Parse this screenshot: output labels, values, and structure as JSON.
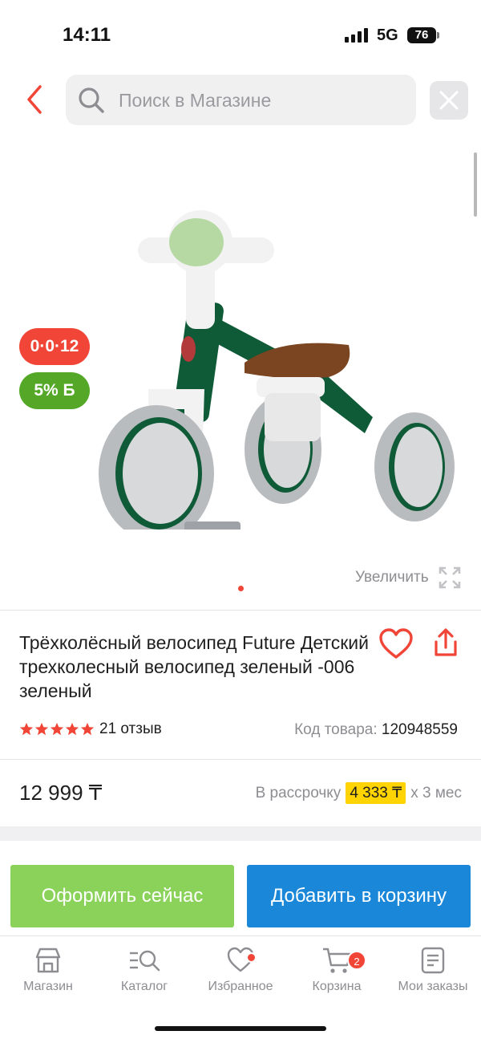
{
  "status_bar": {
    "time": "14:11",
    "network": "5G",
    "battery": "76"
  },
  "header": {
    "search_placeholder": "Поиск в Магазине"
  },
  "gallery": {
    "badges": {
      "age": "0·0·12",
      "bonus": "5% Б"
    },
    "zoom_label": "Увеличить",
    "current_slide": 1
  },
  "product": {
    "title": "Трёхколёсный велосипед Future Детский трехколесный велосипед зеленый -006 зеленый",
    "rating": 5,
    "reviews": "21 отзыв",
    "sku_label": "Код товара:",
    "sku_value": "120948559",
    "price": "12 999 ₸",
    "installment_prefix": "В рассрочку",
    "installment_amount": "4 333 ₸",
    "installment_suffix": "х 3 мес"
  },
  "actions": {
    "buy_now": "Оформить сейчас",
    "add_to_cart": "Добавить в корзину"
  },
  "tabbar": {
    "items": [
      {
        "label": "Магазин",
        "icon": "shop-icon"
      },
      {
        "label": "Каталог",
        "icon": "catalog-search-icon"
      },
      {
        "label": "Избранное",
        "icon": "heart-icon"
      },
      {
        "label": "Корзина",
        "icon": "cart-icon"
      },
      {
        "label": "Мои заказы",
        "icon": "orders-icon"
      }
    ],
    "cart_count": "2"
  },
  "colors": {
    "accent_red": "#f04537",
    "bonus_green": "#55a827",
    "buy_green": "#8bd25a",
    "cart_blue": "#1a87d9",
    "installment_yellow": "#ffd400"
  }
}
